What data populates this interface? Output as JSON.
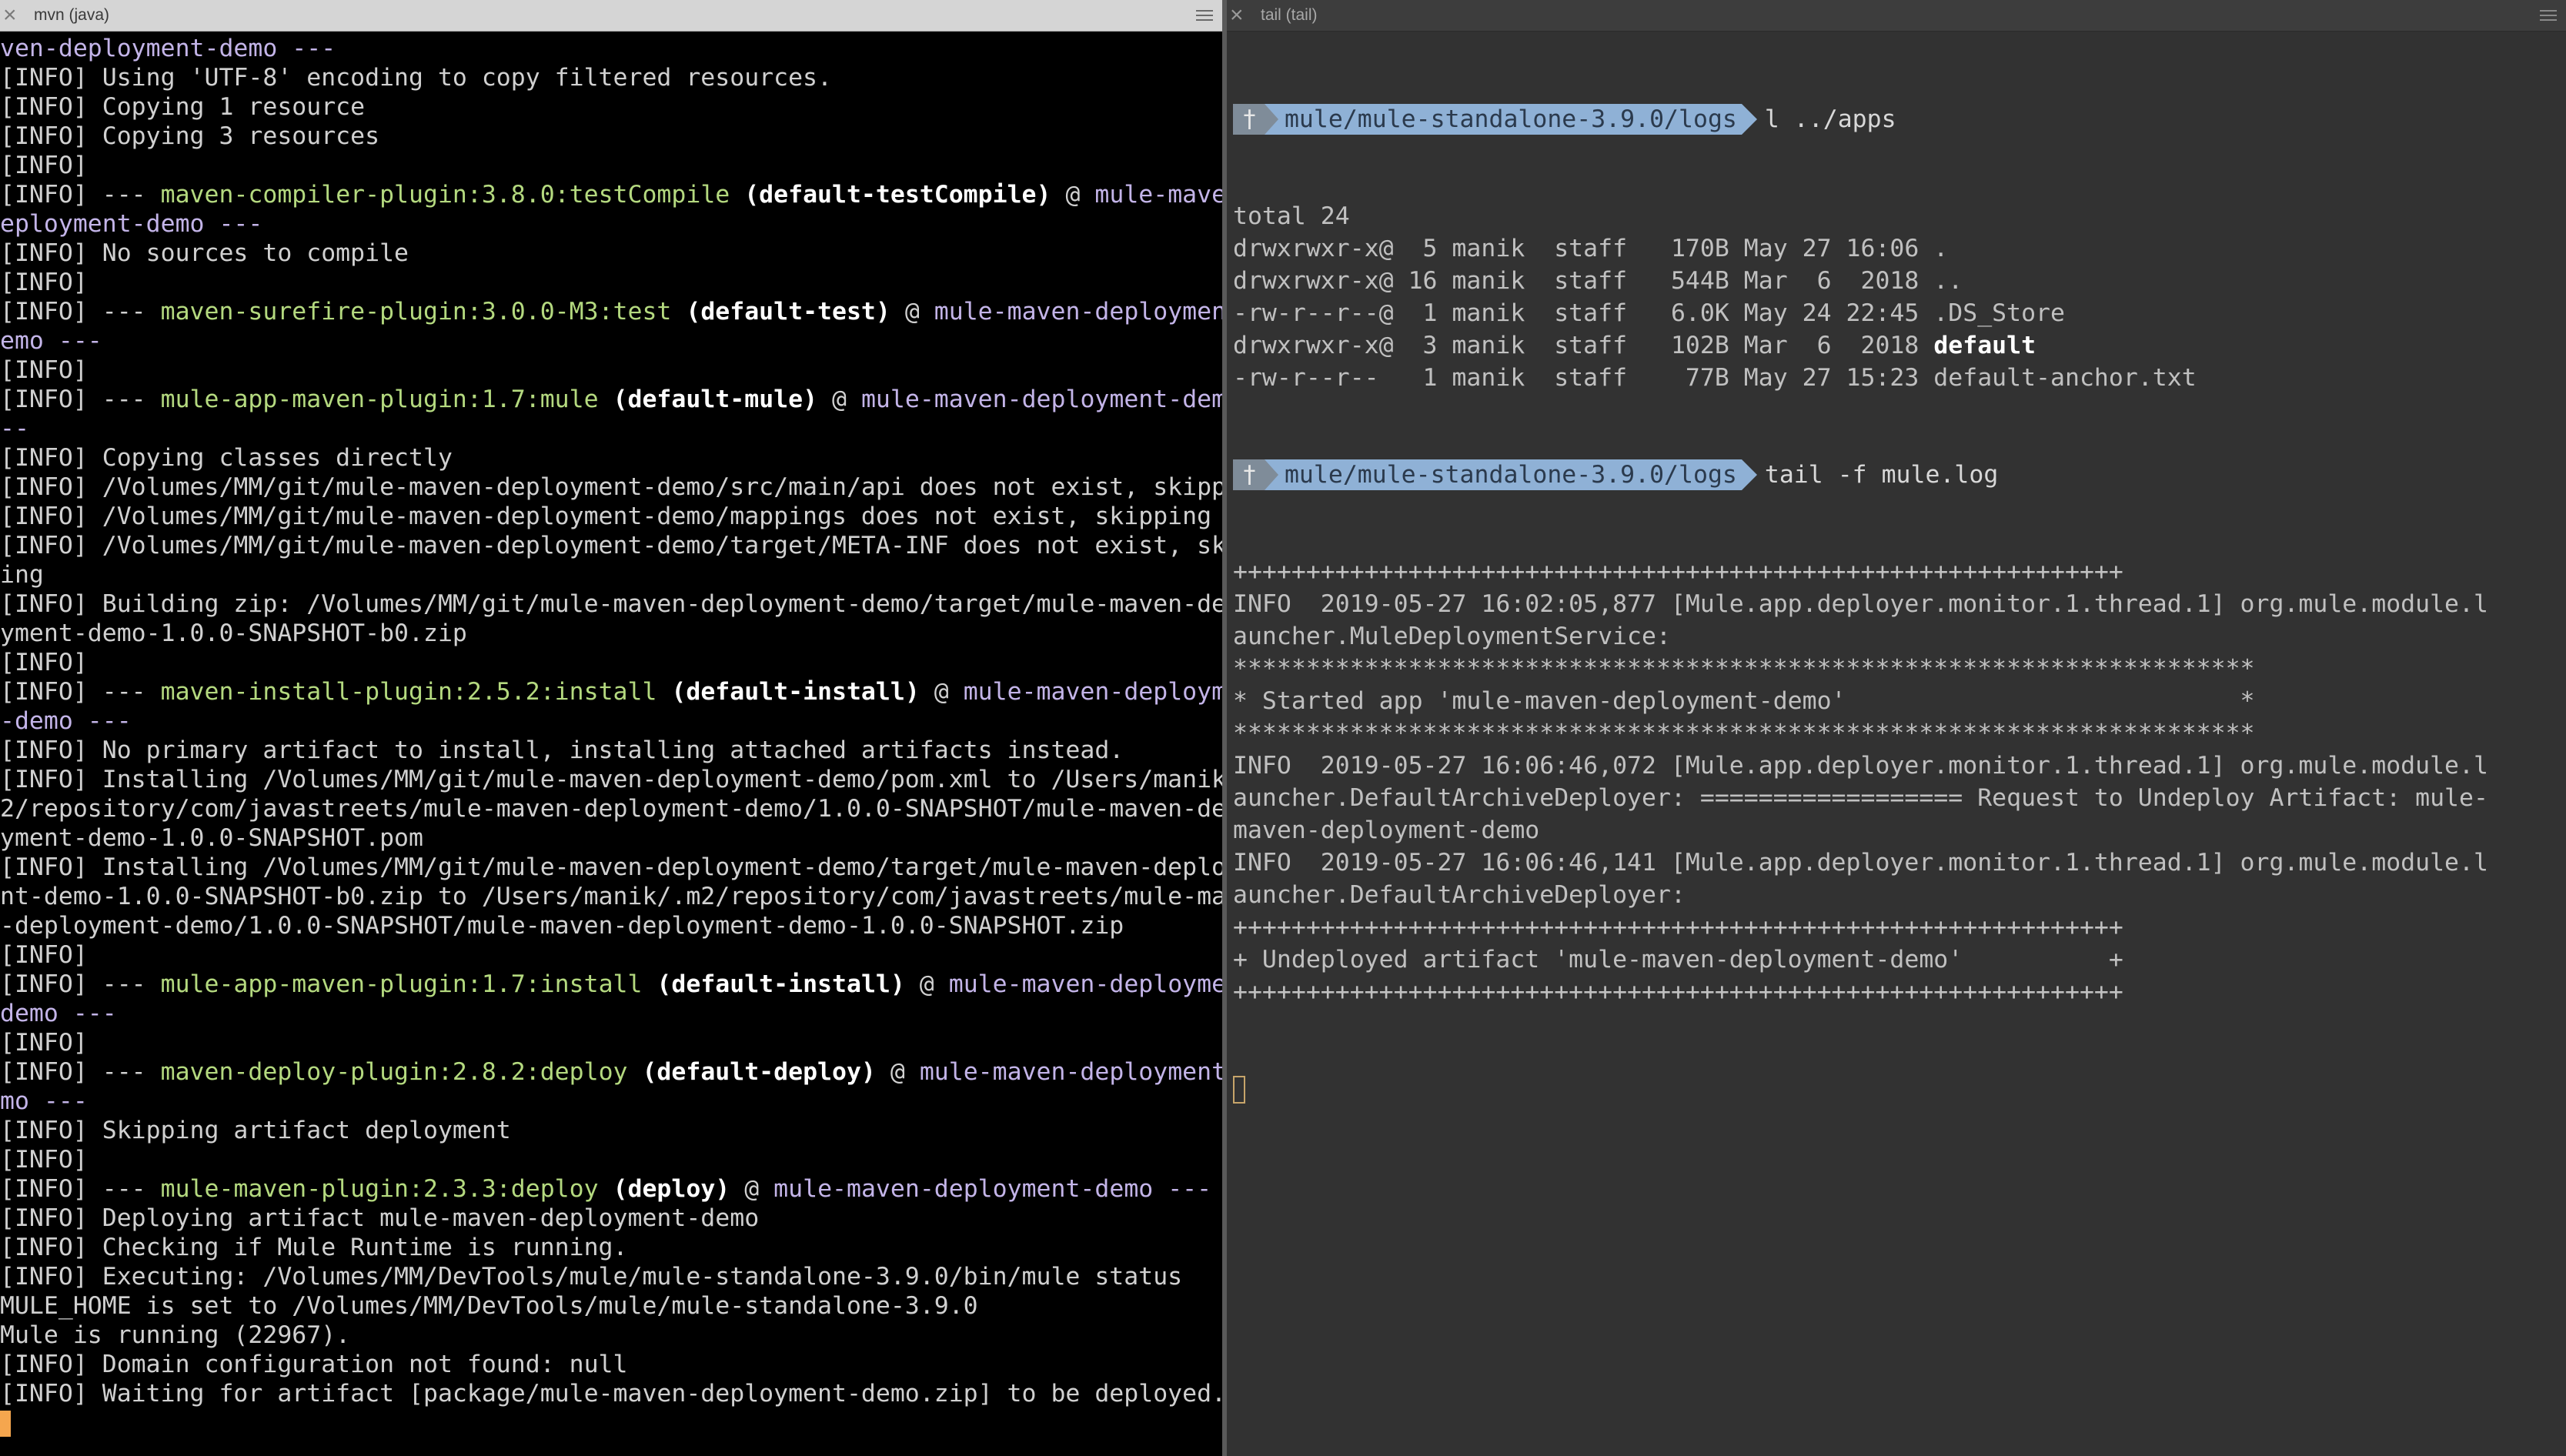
{
  "left_tab": {
    "title": "mvn (java)"
  },
  "right_tab": {
    "title": "tail (tail)"
  },
  "left_terminal": {
    "lines": [
      [
        {
          "t": "ven-deployment-demo ---",
          "c": "c-purple"
        }
      ],
      [
        {
          "t": "[INFO] Using 'UTF-8' encoding to copy filtered resources."
        }
      ],
      [
        {
          "t": "[INFO] Copying 1 resource"
        }
      ],
      [
        {
          "t": "[INFO] Copying 3 resources"
        }
      ],
      [
        {
          "t": "[INFO]"
        }
      ],
      [
        {
          "t": "[INFO] --- "
        },
        {
          "t": "maven-compiler-plugin:3.8.0:testCompile",
          "c": "c-green"
        },
        {
          "t": " (default-testCompile)",
          "c": "c-bold"
        },
        {
          "t": " @ "
        },
        {
          "t": "mule-maven-d",
          "c": "c-purple"
        }
      ],
      [
        {
          "t": "eployment-demo ---",
          "c": "c-purple"
        }
      ],
      [
        {
          "t": "[INFO] No sources to compile"
        }
      ],
      [
        {
          "t": "[INFO]"
        }
      ],
      [
        {
          "t": "[INFO] --- "
        },
        {
          "t": "maven-surefire-plugin:3.0.0-M3:test",
          "c": "c-green"
        },
        {
          "t": " (default-test)",
          "c": "c-bold"
        },
        {
          "t": " @ "
        },
        {
          "t": "mule-maven-deployment-d",
          "c": "c-purple"
        }
      ],
      [
        {
          "t": "emo ---",
          "c": "c-purple"
        }
      ],
      [
        {
          "t": "[INFO]"
        }
      ],
      [
        {
          "t": "[INFO] --- "
        },
        {
          "t": "mule-app-maven-plugin:1.7:mule",
          "c": "c-green"
        },
        {
          "t": " (default-mule)",
          "c": "c-bold"
        },
        {
          "t": " @ "
        },
        {
          "t": "mule-maven-deployment-demo -",
          "c": "c-purple"
        }
      ],
      [
        {
          "t": "--",
          "c": "c-purple"
        }
      ],
      [
        {
          "t": "[INFO] Copying classes directly"
        }
      ],
      [
        {
          "t": "[INFO] /Volumes/MM/git/mule-maven-deployment-demo/src/main/api does not exist, skipping"
        }
      ],
      [
        {
          "t": "[INFO] /Volumes/MM/git/mule-maven-deployment-demo/mappings does not exist, skipping"
        }
      ],
      [
        {
          "t": "[INFO] /Volumes/MM/git/mule-maven-deployment-demo/target/META-INF does not exist, skipp"
        }
      ],
      [
        {
          "t": "ing"
        }
      ],
      [
        {
          "t": "[INFO] Building zip: /Volumes/MM/git/mule-maven-deployment-demo/target/mule-maven-deplo"
        }
      ],
      [
        {
          "t": "yment-demo-1.0.0-SNAPSHOT-b0.zip"
        }
      ],
      [
        {
          "t": "[INFO]"
        }
      ],
      [
        {
          "t": "[INFO] --- "
        },
        {
          "t": "maven-install-plugin:2.5.2:install",
          "c": "c-green"
        },
        {
          "t": " (default-install)",
          "c": "c-bold"
        },
        {
          "t": " @ "
        },
        {
          "t": "mule-maven-deployment",
          "c": "c-purple"
        }
      ],
      [
        {
          "t": "-demo ---",
          "c": "c-purple"
        }
      ],
      [
        {
          "t": "[INFO] No primary artifact to install, installing attached artifacts instead."
        }
      ],
      [
        {
          "t": "[INFO] Installing /Volumes/MM/git/mule-maven-deployment-demo/pom.xml to /Users/manik/.m"
        }
      ],
      [
        {
          "t": "2/repository/com/javastreets/mule-maven-deployment-demo/1.0.0-SNAPSHOT/mule-maven-deplo"
        }
      ],
      [
        {
          "t": "yment-demo-1.0.0-SNAPSHOT.pom"
        }
      ],
      [
        {
          "t": "[INFO] Installing /Volumes/MM/git/mule-maven-deployment-demo/target/mule-maven-deployme"
        }
      ],
      [
        {
          "t": "nt-demo-1.0.0-SNAPSHOT-b0.zip to /Users/manik/.m2/repository/com/javastreets/mule-maven"
        }
      ],
      [
        {
          "t": "-deployment-demo/1.0.0-SNAPSHOT/mule-maven-deployment-demo-1.0.0-SNAPSHOT.zip"
        }
      ],
      [
        {
          "t": "[INFO]"
        }
      ],
      [
        {
          "t": "[INFO] --- "
        },
        {
          "t": "mule-app-maven-plugin:1.7:install",
          "c": "c-green"
        },
        {
          "t": " (default-install)",
          "c": "c-bold"
        },
        {
          "t": " @ "
        },
        {
          "t": "mule-maven-deployment-",
          "c": "c-purple"
        }
      ],
      [
        {
          "t": "demo ---",
          "c": "c-purple"
        }
      ],
      [
        {
          "t": "[INFO]"
        }
      ],
      [
        {
          "t": "[INFO] --- "
        },
        {
          "t": "maven-deploy-plugin:2.8.2:deploy",
          "c": "c-green"
        },
        {
          "t": " (default-deploy)",
          "c": "c-bold"
        },
        {
          "t": " @ "
        },
        {
          "t": "mule-maven-deployment-de",
          "c": "c-purple"
        }
      ],
      [
        {
          "t": "mo ---",
          "c": "c-purple"
        }
      ],
      [
        {
          "t": "[INFO] Skipping artifact deployment"
        }
      ],
      [
        {
          "t": "[INFO]"
        }
      ],
      [
        {
          "t": "[INFO] --- "
        },
        {
          "t": "mule-maven-plugin:2.3.3:deploy",
          "c": "c-green"
        },
        {
          "t": " (deploy)",
          "c": "c-bold"
        },
        {
          "t": " @ "
        },
        {
          "t": "mule-maven-deployment-demo ---",
          "c": "c-purple"
        }
      ],
      [
        {
          "t": "[INFO] Deploying artifact mule-maven-deployment-demo"
        }
      ],
      [
        {
          "t": "[INFO] Checking if Mule Runtime is running."
        }
      ],
      [
        {
          "t": "[INFO] Executing: /Volumes/MM/DevTools/mule/mule-standalone-3.9.0/bin/mule status"
        }
      ],
      [
        {
          "t": "MULE_HOME is set to /Volumes/MM/DevTools/mule/mule-standalone-3.9.0"
        }
      ],
      [
        {
          "t": "Mule is running (22967)."
        }
      ],
      [
        {
          "t": "[INFO] Domain configuration not found: null"
        }
      ],
      [
        {
          "t": "[INFO] Waiting for artifact [package/mule-maven-deployment-demo.zip] to be deployed."
        }
      ]
    ]
  },
  "right_terminal": {
    "prompt_root": "†",
    "prompt_path": "mule/mule-standalone-3.9.0/logs",
    "cmd1": "l ../apps",
    "ls_lines": [
      [
        {
          "t": "total 24"
        }
      ],
      [
        {
          "t": "drwxrwxr-x@  5 manik  staff   170B May 27 16:06 ."
        }
      ],
      [
        {
          "t": "drwxrwxr-x@ 16 manik  staff   544B Mar  6  2018 .."
        }
      ],
      [
        {
          "t": "-rw-r--r--@  1 manik  staff   6.0K May 24 22:45 .DS_Store"
        }
      ],
      [
        {
          "t": "drwxrwxr-x@  3 manik  staff   102B Mar  6  2018 "
        },
        {
          "t": "default",
          "c": "c-bold"
        }
      ],
      [
        {
          "t": "-rw-r--r--   1 manik  staff    77B May 27 15:23 default-anchor.txt"
        }
      ]
    ],
    "cmd2": "tail -f mule.log",
    "log_lines": [
      [
        {
          "t": "+++++++++++++++++++++++++++++++++++++++++++++++++++++++++++++"
        }
      ],
      [
        {
          "t": "INFO  2019-05-27 16:02:05,877 [Mule.app.deployer.monitor.1.thread.1] org.mule.module.l"
        }
      ],
      [
        {
          "t": "auncher.MuleDeploymentService:"
        }
      ],
      [
        {
          "t": "**********************************************************************"
        }
      ],
      [
        {
          "t": "* Started app 'mule-maven-deployment-demo'                           *"
        }
      ],
      [
        {
          "t": "**********************************************************************"
        }
      ],
      [
        {
          "t": "INFO  2019-05-27 16:06:46,072 [Mule.app.deployer.monitor.1.thread.1] org.mule.module.l"
        }
      ],
      [
        {
          "t": "auncher.DefaultArchiveDeployer: ================== Request to Undeploy Artifact: mule-"
        }
      ],
      [
        {
          "t": "maven-deployment-demo"
        }
      ],
      [
        {
          "t": "INFO  2019-05-27 16:06:46,141 [Mule.app.deployer.monitor.1.thread.1] org.mule.module.l"
        }
      ],
      [
        {
          "t": "auncher.DefaultArchiveDeployer:"
        }
      ],
      [
        {
          "t": "+++++++++++++++++++++++++++++++++++++++++++++++++++++++++++++"
        }
      ],
      [
        {
          "t": "+ Undeployed artifact 'mule-maven-deployment-demo'          +"
        }
      ],
      [
        {
          "t": "+++++++++++++++++++++++++++++++++++++++++++++++++++++++++++++"
        }
      ]
    ]
  },
  "colors": {
    "left_bg": "#000000",
    "right_bg": "#323232",
    "plugin_green": "#b4d97f",
    "project_purple": "#c3b4e8",
    "prompt_path_bg": "#8fb1d6",
    "cursor_left": "#f5a64e"
  },
  "icons": {
    "close": "close-icon",
    "menu": "hamburger-menu-icon"
  }
}
